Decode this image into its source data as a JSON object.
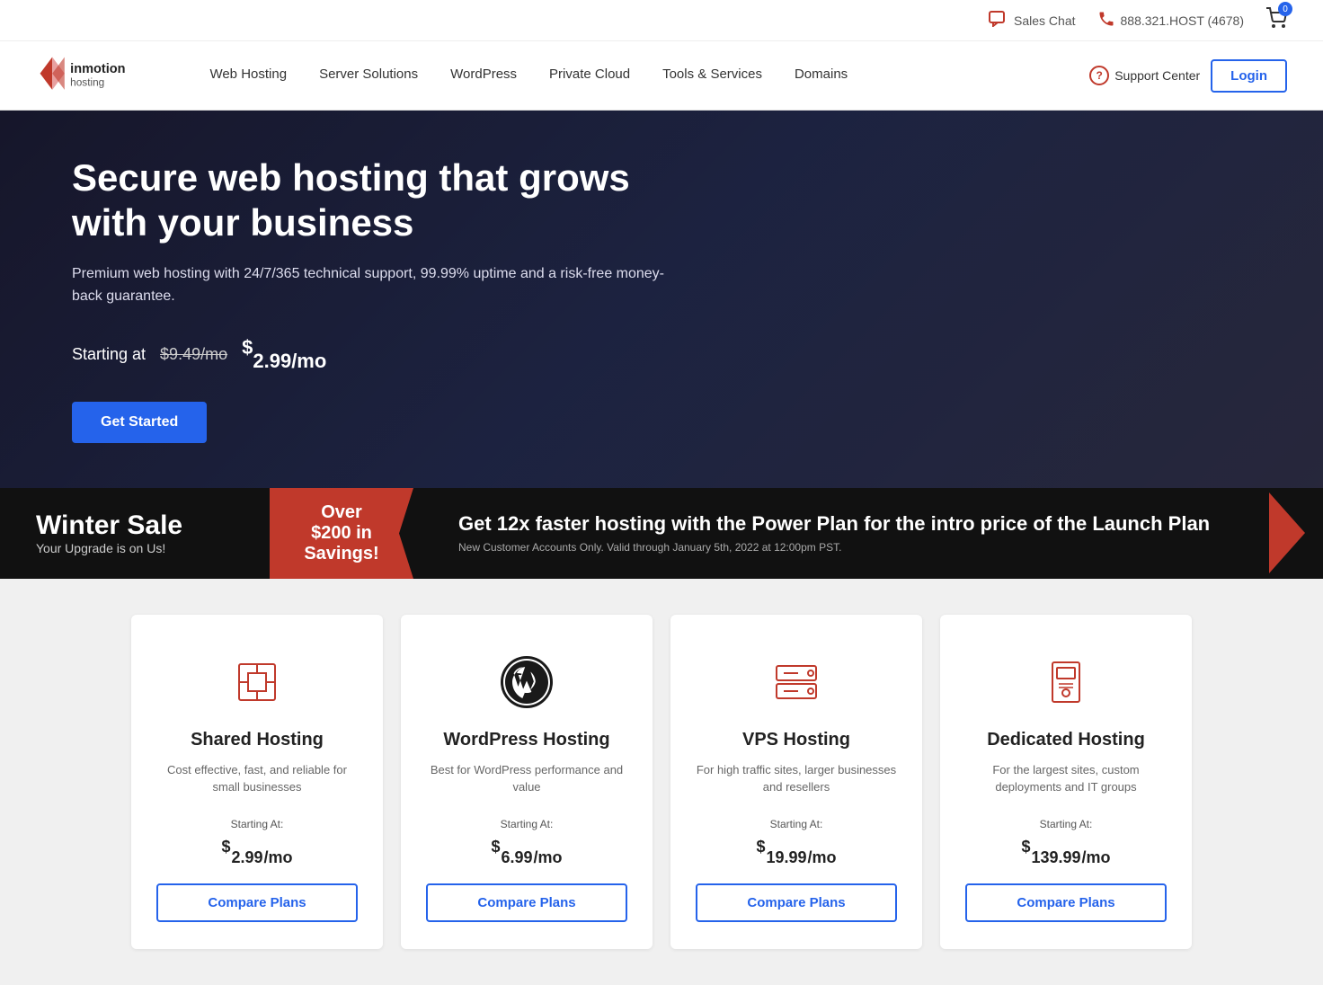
{
  "topbar": {
    "sales_chat_label": "Sales Chat",
    "phone_number": "888.321.HOST (4678)",
    "cart_count": "0"
  },
  "nav": {
    "logo_alt": "InMotion Hosting",
    "links": [
      {
        "id": "web-hosting",
        "label": "Web Hosting"
      },
      {
        "id": "server-solutions",
        "label": "Server Solutions"
      },
      {
        "id": "wordpress",
        "label": "WordPress"
      },
      {
        "id": "private-cloud",
        "label": "Private Cloud"
      },
      {
        "id": "tools-services",
        "label": "Tools & Services"
      },
      {
        "id": "domains",
        "label": "Domains"
      }
    ],
    "support_center_label": "Support Center",
    "login_label": "Login"
  },
  "hero": {
    "heading": "Secure web hosting that grows with your business",
    "subheading": "Premium web hosting with 24/7/365 technical support, 99.99% uptime and a risk-free money-back guarantee.",
    "price_prefix": "Starting at",
    "old_price": "$9.49/mo",
    "new_price_dollar": "$",
    "new_price_amount": "2.99",
    "new_price_suffix": "/mo",
    "cta_label": "Get Started"
  },
  "sale_banner": {
    "title": "Winter Sale",
    "subtitle": "Your Upgrade is on Us!",
    "badge_line1": "Over",
    "badge_line2": "$200 in",
    "badge_line3": "Savings!",
    "description": "Get 12x faster hosting with the Power Plan for the intro price of the Launch Plan",
    "fine_print": "New Customer Accounts Only. Valid through January 5th, 2022 at 12:00pm PST."
  },
  "cards": [
    {
      "id": "shared-hosting",
      "icon_type": "box-outline",
      "title": "Shared Hosting",
      "description": "Cost effective, fast, and reliable for small businesses",
      "price_label": "Starting At:",
      "price_dollar": "$",
      "price_amount": "2.99",
      "price_suffix": "/mo",
      "cta": "Compare Plans"
    },
    {
      "id": "wordpress-hosting",
      "icon_type": "wordpress",
      "title": "WordPress Hosting",
      "description": "Best for WordPress performance and value",
      "price_label": "Starting At:",
      "price_dollar": "$",
      "price_amount": "6.99",
      "price_suffix": "/mo",
      "cta": "Compare Plans"
    },
    {
      "id": "vps-hosting",
      "icon_type": "server",
      "title": "VPS Hosting",
      "description": "For high traffic sites, larger businesses and resellers",
      "price_label": "Starting At:",
      "price_dollar": "$",
      "price_amount": "19.99",
      "price_suffix": "/mo",
      "cta": "Compare Plans"
    },
    {
      "id": "dedicated-hosting",
      "icon_type": "server-dedicated",
      "title": "Dedicated Hosting",
      "description": "For the largest sites, custom deployments and IT groups",
      "price_label": "Starting At:",
      "price_dollar": "$",
      "price_amount": "139.99",
      "price_suffix": "/mo",
      "cta": "Compare Plans"
    }
  ]
}
